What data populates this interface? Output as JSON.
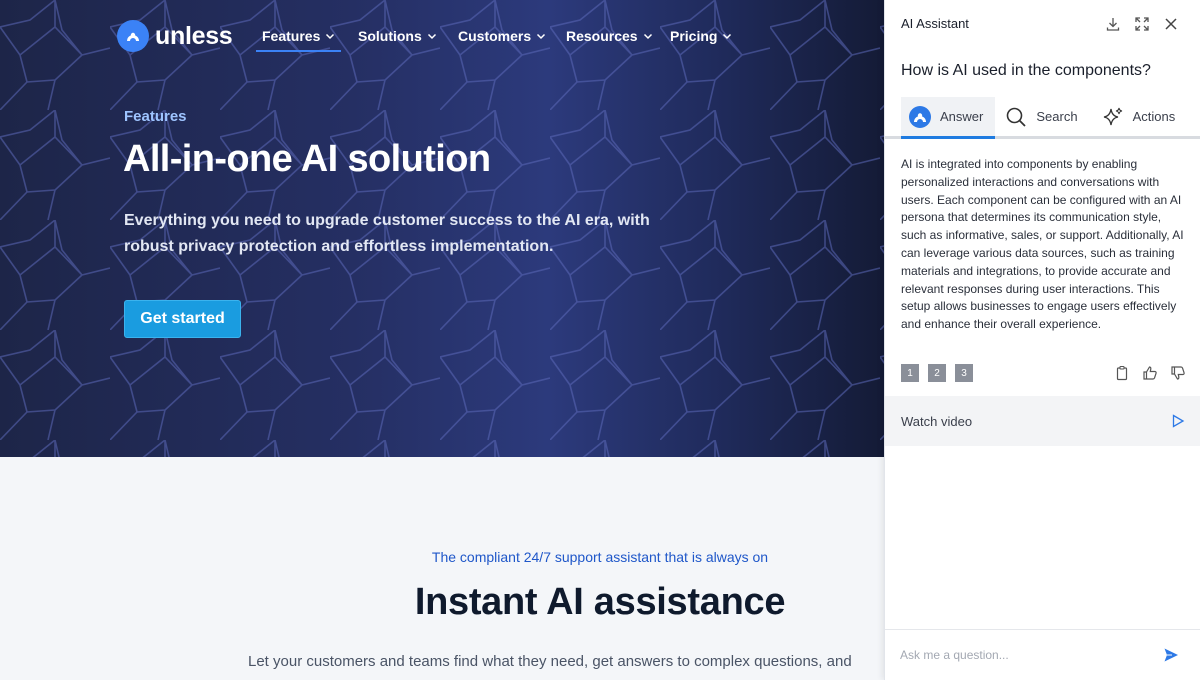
{
  "brand": {
    "name": "unless",
    "accent": "#3b82f6"
  },
  "nav": {
    "items": [
      {
        "label": "Features",
        "active": true
      },
      {
        "label": "Solutions"
      },
      {
        "label": "Customers"
      },
      {
        "label": "Resources"
      },
      {
        "label": "Pricing"
      }
    ]
  },
  "hero": {
    "eyebrow": "Features",
    "title": "All-in-one AI solution",
    "subtitle": "Everything you need to upgrade customer success to the AI era, with robust privacy protection and effortless implementation.",
    "cta": "Get started"
  },
  "section": {
    "eyebrow": "The compliant 24/7 support assistant that is always on",
    "title": "Instant AI assistance",
    "text": "Let your customers and teams find what they need, get answers to complex questions, and"
  },
  "assistant": {
    "title": "AI Assistant",
    "header_icons": [
      "download-icon",
      "expand-icon",
      "close-icon"
    ],
    "question": "How is AI used in the components?",
    "tabs": [
      {
        "label": "Answer",
        "icon": "unless-logo-icon",
        "active": true
      },
      {
        "label": "Search",
        "icon": "search-icon"
      },
      {
        "label": "Actions",
        "icon": "sparkle-icon"
      }
    ],
    "answer": "AI is integrated into components by enabling personalized interactions and conversations with users. Each component can be configured with an AI persona that determines its communication style, such as informative, sales, or support. Additionally, AI can leverage various data sources, such as training materials and integrations, to provide accurate and relevant responses during user interactions. This setup allows businesses to engage users effectively and enhance their overall experience.",
    "references": [
      "1",
      "2",
      "3"
    ],
    "feedback_icons": [
      "copy-icon",
      "thumbs-up-icon",
      "thumbs-down-icon"
    ],
    "watch_video": "Watch video",
    "input_placeholder": "Ask me a question...",
    "send_icon": "send-icon"
  }
}
